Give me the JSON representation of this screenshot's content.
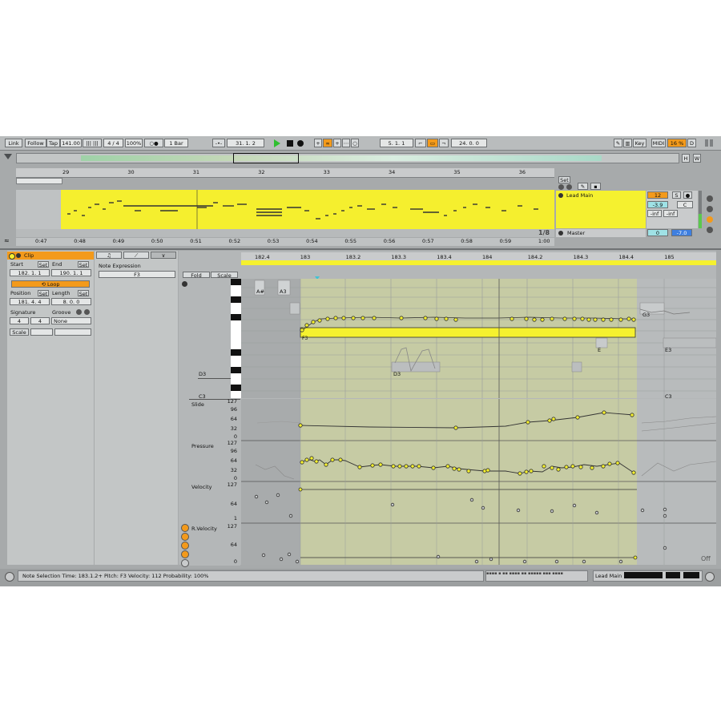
{
  "control_bar": {
    "link": "Link",
    "follow": "Follow",
    "tap": "Tap",
    "tempo": "141.00",
    "time_signature": "4 / 4",
    "zoom": "100%",
    "metronome": "○●",
    "quantize": "1 Bar",
    "arrangement_position": "31.  1.  2",
    "punch_in": "5.  1.  1",
    "loop_length": "24.  0.  0",
    "key": "Key",
    "midi": "MIDI",
    "cpu": "16 %",
    "cpu_indicator": "D"
  },
  "overview": {
    "h_button": "H",
    "w_button": "W"
  },
  "arrangement": {
    "bar_numbers": [
      "29",
      "30",
      "31",
      "32",
      "33",
      "34",
      "35",
      "36"
    ],
    "time_labels": [
      "0:47",
      "0:48",
      "0:49",
      "0:50",
      "0:51",
      "0:52",
      "0:53",
      "0:54",
      "0:55",
      "0:56",
      "0:57",
      "0:58",
      "0:59",
      "1:00"
    ],
    "set_button": "Set",
    "zoom_fraction": "1/8",
    "tracks": [
      {
        "name": "Lead Main",
        "number": "12",
        "solo": "S",
        "volume": "-3.9",
        "pan": "C",
        "send_a": "-inf",
        "send_b": "-inf"
      },
      {
        "name": "Master",
        "volume": "0",
        "pan": "-7.0"
      }
    ]
  },
  "clip_panel": {
    "title": "Clip",
    "start_label": "Start",
    "end_label": "End",
    "set": "Set",
    "start_value": "182.  1.  1",
    "end_value": "190.  1.  1",
    "loop": "Loop",
    "position_label": "Position",
    "length_label": "Length",
    "position_value": "181.  4.  4",
    "length_value": "8.  0.  0",
    "signature_label": "Signature",
    "groove_label": "Groove",
    "sig_num": "4",
    "sig_den": "4",
    "groove_value": "None",
    "scale_label": "Scale"
  },
  "expression_panel": {
    "tabs": [
      "♫",
      "⟋",
      "∨"
    ],
    "title": "Note Expression",
    "note": "F3"
  },
  "editor": {
    "fold": "Fold",
    "scale": "Scale",
    "ruler": [
      "182.4",
      "183",
      "183.2",
      "183.3",
      "183.4",
      "184",
      "184.2",
      "184.3",
      "184.4",
      "185"
    ],
    "note_labels": [
      {
        "id": "a_sharp",
        "text": "A#"
      },
      {
        "id": "a3",
        "text": "A3"
      },
      {
        "id": "g3",
        "text": "G3"
      },
      {
        "id": "f3",
        "text": "F3"
      },
      {
        "id": "e_left",
        "text": "E"
      },
      {
        "id": "e3",
        "text": "E3"
      },
      {
        "id": "d3_key",
        "text": "D3"
      },
      {
        "id": "d3_note",
        "text": "D3"
      },
      {
        "id": "c3",
        "text": "C3"
      },
      {
        "id": "c3_right",
        "text": "C3"
      }
    ],
    "lanes": [
      {
        "name": "Slide",
        "scale": [
          "127",
          "96",
          "64",
          "32",
          "0"
        ]
      },
      {
        "name": "Pressure",
        "scale": [
          "127",
          "96",
          "64",
          "32",
          "0"
        ]
      },
      {
        "name": "Velocity",
        "scale": [
          "127",
          "64",
          "1"
        ]
      },
      {
        "name": "R.Velocity",
        "scale": [
          "127",
          "64",
          "0"
        ]
      }
    ],
    "off": "Off"
  },
  "status_bar": {
    "text": "Note Selection   Time: 183.1.2+   Pitch: F3   Velocity: 112   Probability: 100%",
    "track": "Lead Main"
  },
  "colors": {
    "accent": "#f39a1b",
    "clip": "#f5f12f",
    "background": "#a7aaab"
  }
}
